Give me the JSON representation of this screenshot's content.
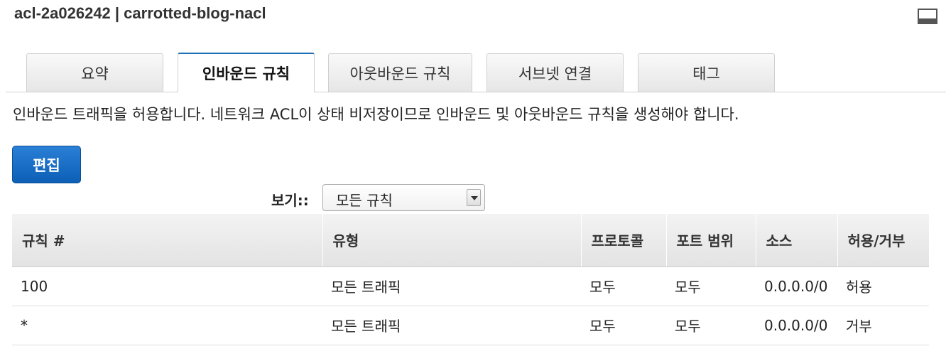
{
  "header": {
    "title": "acl-2a026242 | carrotted-blog-nacl",
    "minimize_icon": "minimize-icon"
  },
  "tabs": [
    {
      "label": "요약",
      "active": false
    },
    {
      "label": "인바운드 규칙",
      "active": true
    },
    {
      "label": "아웃바운드 규칙",
      "active": false
    },
    {
      "label": "서브넷 연결",
      "active": false
    },
    {
      "label": "태그",
      "active": false
    }
  ],
  "description": "인바운드 트래픽을 허용합니다. 네트워크 ACL이 상태 비저장이므로 인바운드 및 아웃바운드 규칙을 생성해야 합니다.",
  "toolbar": {
    "edit_label": "편집"
  },
  "view_filter": {
    "label": "보기::",
    "selected": "모든 규칙"
  },
  "table": {
    "columns": [
      "규칙 #",
      "유형",
      "프로토콜",
      "포트 범위",
      "소스",
      "허용/거부"
    ],
    "rows": [
      {
        "rule": "100",
        "type": "모든 트래픽",
        "protocol": "모두",
        "port": "모두",
        "source": "0.0.0.0/0",
        "action": "허용"
      },
      {
        "rule": "*",
        "type": "모든 트래픽",
        "protocol": "모두",
        "port": "모두",
        "source": "0.0.0.0/0",
        "action": "거부"
      }
    ]
  },
  "colors": {
    "accent": "#1f6fb5",
    "allow": "#1e8a1e",
    "deny": "#cc1a1a"
  }
}
